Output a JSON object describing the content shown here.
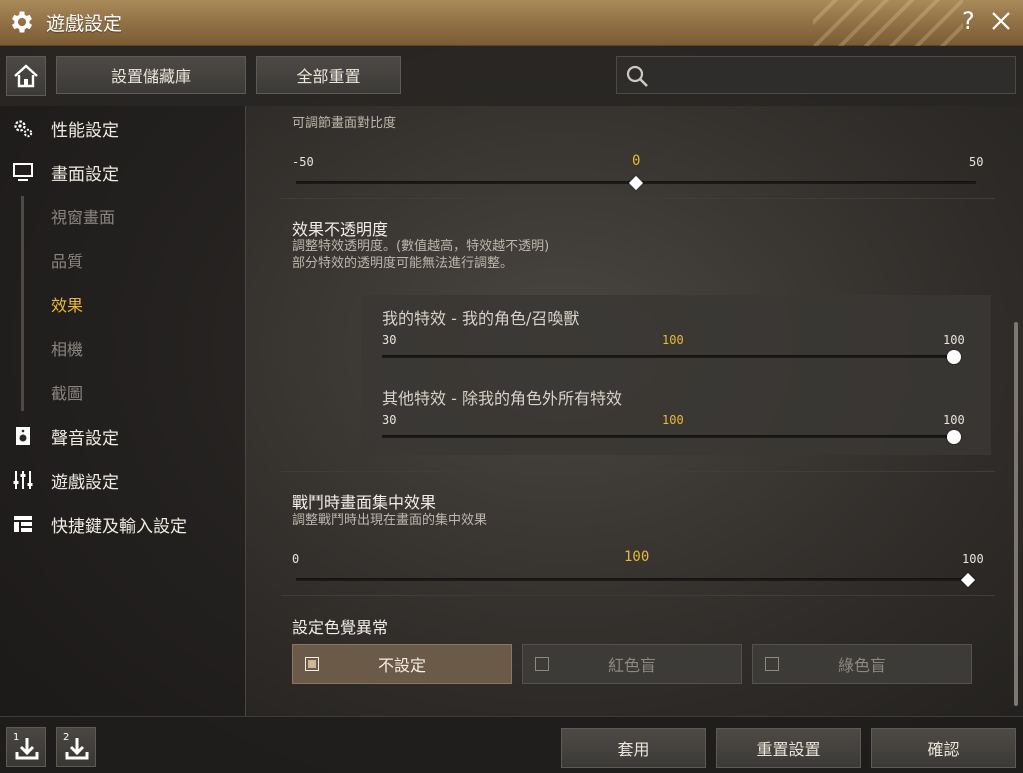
{
  "window": {
    "title": "遊戲設定",
    "help_label": "?"
  },
  "toolbar": {
    "save_library_label": "設置儲藏庫",
    "reset_all_label": "全部重置",
    "search_placeholder": ""
  },
  "sidebar": {
    "items": [
      {
        "label": "性能設定",
        "icon": "gears-icon"
      },
      {
        "label": "畫面設定",
        "icon": "monitor-icon"
      },
      {
        "label": "視窗畫面",
        "sub": true
      },
      {
        "label": "品質",
        "sub": true
      },
      {
        "label": "效果",
        "sub": true,
        "active": true
      },
      {
        "label": "相機",
        "sub": true
      },
      {
        "label": "截圖",
        "sub": true
      },
      {
        "label": "聲音設定",
        "icon": "speaker-icon"
      },
      {
        "label": "遊戲設定",
        "icon": "sliders-icon"
      },
      {
        "label": "快捷鍵及輸入設定",
        "icon": "keyboard-layout-icon"
      }
    ]
  },
  "content": {
    "contrast": {
      "desc": "可調節畫面對比度",
      "min": "-50",
      "value": "0",
      "max": "50",
      "fraction": 0.5
    },
    "effect_opacity": {
      "title": "效果不透明度",
      "desc_line1": "調整特效透明度。(數值越高，特效越不透明)",
      "desc_line2": "部分特效的透明度可能無法進行調整。",
      "mine": {
        "label": "我的特效 - 我的角色/召喚獸",
        "min": "30",
        "value": "100",
        "max": "100",
        "fraction": 1.0
      },
      "others": {
        "label": "其他特效 - 除我的角色外所有特效",
        "min": "30",
        "value": "100",
        "max": "100",
        "fraction": 1.0
      }
    },
    "combat_focus": {
      "title": "戰鬥時畫面集中效果",
      "desc": "調整戰鬥時出現在畫面的集中效果",
      "min": "0",
      "value": "100",
      "max": "100",
      "fraction": 1.0
    },
    "color_blind": {
      "title": "設定色覺異常",
      "options": [
        {
          "label": "不設定",
          "selected": true
        },
        {
          "label": "紅色盲",
          "selected": false
        },
        {
          "label": "綠色盲",
          "selected": false
        }
      ]
    }
  },
  "footer": {
    "presets": [
      "1",
      "2"
    ],
    "apply_label": "套用",
    "reset_label": "重置設置",
    "confirm_label": "確認"
  },
  "colors": {
    "accent": "#e8b838",
    "titlebar": "#9a7a4c"
  }
}
